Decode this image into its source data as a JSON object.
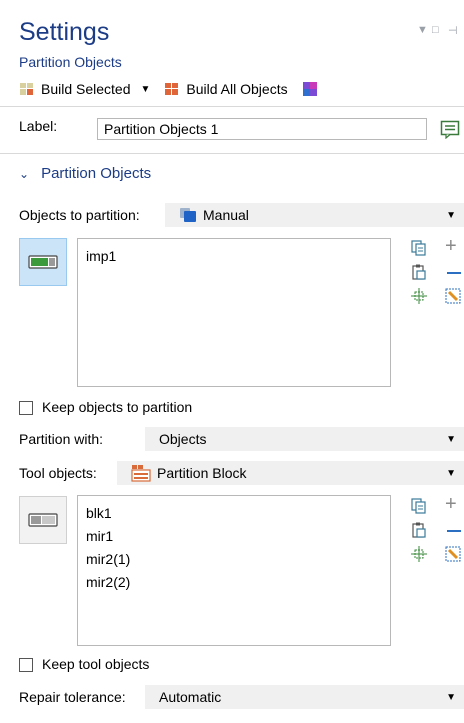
{
  "header": {
    "title": "Settings",
    "subtitle": "Partition Objects"
  },
  "toolbar": {
    "build_selected_label": "Build Selected",
    "build_all_label": "Build All Objects"
  },
  "label_field": {
    "label": "Label:",
    "value": "Partition Objects 1"
  },
  "section": {
    "title": "Partition Objects"
  },
  "objects_to_partition": {
    "label": "Objects to partition:",
    "selected": "Manual",
    "items": [
      "imp1"
    ]
  },
  "keep_objects": {
    "label": "Keep objects to partition",
    "checked": false
  },
  "partition_with": {
    "label": "Partition with:",
    "selected": "Objects"
  },
  "tool_objects": {
    "label": "Tool objects:",
    "selected": "Partition Block",
    "items": [
      "blk1",
      "mir1",
      "mir2(1)",
      "mir2(2)"
    ]
  },
  "keep_tool_objects": {
    "label": "Keep tool objects",
    "checked": false
  },
  "repair_tolerance": {
    "label": "Repair tolerance:",
    "selected": "Automatic"
  },
  "colors": {
    "heading": "#1c3c86",
    "selection_active": "#cce4f7",
    "combo_bg": "#f0f0f0"
  }
}
